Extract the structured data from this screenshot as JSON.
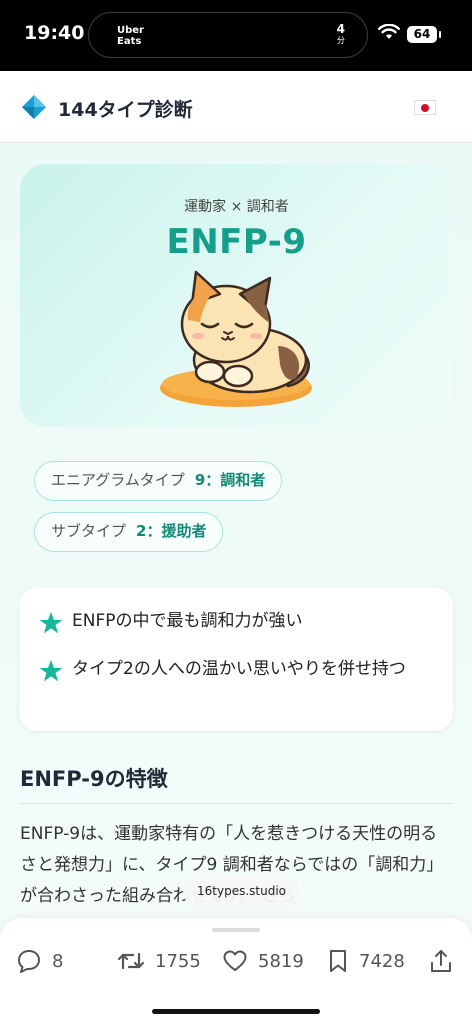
{
  "status_bar": {
    "time": "19:40",
    "live_activity": {
      "brand": "Uber\nEats",
      "eta_value": "4",
      "eta_unit": "分"
    },
    "battery": "64"
  },
  "header": {
    "title": "144タイプ診断",
    "language_flag": "japan-flag"
  },
  "hero": {
    "subtitle": "運動家 × 調和者",
    "type_code": "ENFP-9",
    "illustration": "sleeping-cat"
  },
  "tags": [
    {
      "label": "エニアグラムタイプ",
      "value": "9：調和者"
    },
    {
      "label": "サブタイプ",
      "value": "2：援助者"
    }
  ],
  "traits": [
    "ENFPの中で最も調和力が強い",
    "タイプ2の人への温かい思いやりを併せ持つ"
  ],
  "section": {
    "title": "ENFP-9の特徴",
    "body": "ENFP-9は、運動家特有の「人を惹きつける天性の明るさと発想力」に、タイプ9 調和者ならではの「調和力」が合わさった組み合わせです。 さら"
  },
  "source_pill": "16types.studio",
  "actions": {
    "replies": "8",
    "reposts": "1755",
    "likes": "5819",
    "bookmarks": "7428"
  },
  "colors": {
    "accent": "#159f8a",
    "star": "#1bb59d"
  }
}
